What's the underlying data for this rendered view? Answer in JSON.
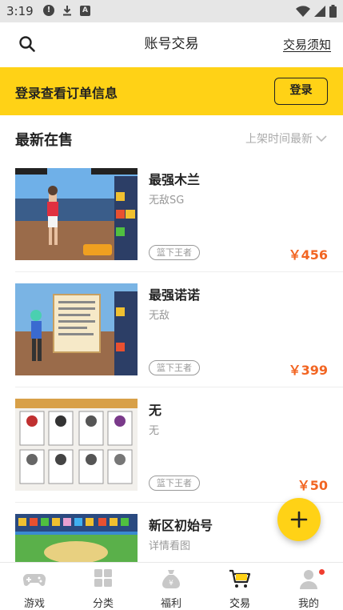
{
  "status_bar": {
    "time": "3:19",
    "left_icons": [
      "alert-circle-icon",
      "download-icon",
      "a-badge-icon"
    ],
    "right_icons": [
      "wifi-icon",
      "signal-icon",
      "battery-icon"
    ]
  },
  "header": {
    "title": "账号交易",
    "notice_link": "交易须知",
    "search_icon": "search-icon"
  },
  "login_banner": {
    "text": "登录查看订单信息",
    "button": "登录",
    "background": "#ffd216"
  },
  "section": {
    "title": "最新在售",
    "sort_label": "上架时间最新"
  },
  "listings": [
    {
      "title": "最强木兰",
      "subtitle": "无敌SG",
      "tag": "篮下王者",
      "price": "￥456"
    },
    {
      "title": "最强诺诺",
      "subtitle": "无敌",
      "tag": "篮下王者",
      "price": "￥399"
    },
    {
      "title": "无",
      "subtitle": "无",
      "tag": "篮下王者",
      "price": "￥50"
    },
    {
      "title": "新区初始号",
      "subtitle": "详情看图",
      "tag": "",
      "price": ""
    }
  ],
  "fab": {
    "icon": "plus-icon"
  },
  "tabs": [
    {
      "label": "游戏",
      "icon": "gamepad-icon",
      "active": false
    },
    {
      "label": "分类",
      "icon": "grid-icon",
      "active": false
    },
    {
      "label": "福利",
      "icon": "gift-bag-icon",
      "active": false
    },
    {
      "label": "交易",
      "icon": "cart-icon",
      "active": true
    },
    {
      "label": "我的",
      "icon": "user-icon",
      "active": false
    }
  ],
  "colors": {
    "accent": "#ffd216",
    "price": "#f26522",
    "badge": "#f03d2f"
  }
}
